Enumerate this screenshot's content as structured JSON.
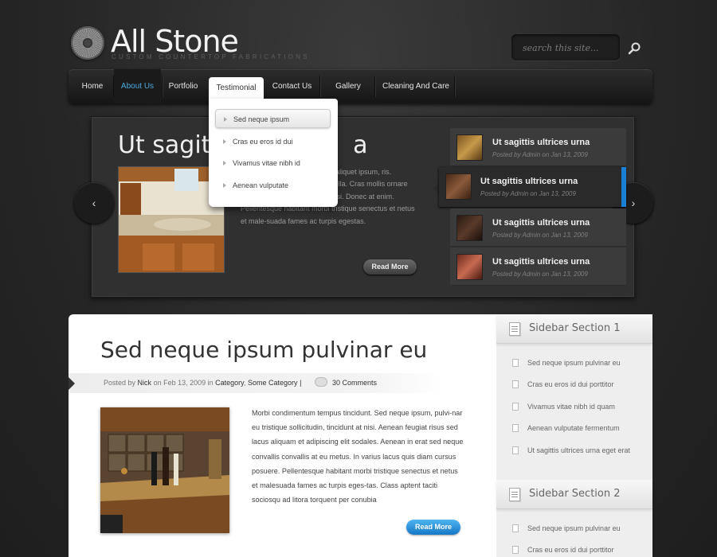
{
  "header": {
    "title": "All Stone",
    "tagline": "CUSTOM COUNTERTOP FABRICATIONS",
    "search_placeholder": "search this site..."
  },
  "nav": {
    "items": [
      "Home",
      "About Us",
      "Portfolio",
      "Testimonial",
      "Contact Us",
      "Gallery",
      "Cleaning And Care"
    ],
    "active": "About Us",
    "open": "Testimonial",
    "dropdown": [
      "Sed neque ipsum",
      "Cras eu eros id dui",
      "Vivamus vitae nibh id",
      "Aenean vulputate"
    ]
  },
  "slider": {
    "title": "Ut sagittis ultrices urna",
    "title_visible": "Ut sagittis",
    "title_tail": "a",
    "text_visible": "ullam vestibulum, odio neque aliquet ipsum, ris. Suspendisse aliquet sem ut nulla. Cras mollis ornare nisl. Morbi ac mi. Nunc eget nisi. Donec at enim. Pellentesque habitant morbi tristique senectus et netus et male-suada fames ac turpis egestas.",
    "read_more": "Read More",
    "prev_arrow": "‹",
    "next_arrow": "›",
    "thumbs": [
      {
        "title": "Ut sagittis ultrices urna",
        "meta": "Posted by Admin on Jan 13, 2009"
      },
      {
        "title": "Ut sagittis ultrices urna",
        "meta": "Posted by Admin on Jan 13, 2009"
      },
      {
        "title": "Ut sagittis ultrices urna",
        "meta": "Posted by Admin on Jan 13, 2009"
      },
      {
        "title": "Ut sagittis ultrices urna",
        "meta": "Posted by Admin on Jan 13, 2009"
      }
    ],
    "active_thumb": 1
  },
  "post": {
    "title": "Sed neque ipsum pulvinar eu",
    "meta_prefix": "Posted by",
    "author": "Nick",
    "meta_on": "on Feb 13, 2009 in",
    "category1": "Category",
    "category2": "Some Category",
    "meta_sep": "|",
    "comments": "30 Comments",
    "body": "Morbi condimentum tempus tincidunt. Sed neque ipsum, pulvi-nar eu tristique sollicitudin, tincidunt at nisi. Aenean feugiat risus sed lacus aliquam et adipiscing elit sodales. Aenean in erat sed neque convallis convallis at eu metus. In varius lacus quis diam cursus posuere. Pellentesque habitant morbi tristique senectus et netus et malesuada fames ac turpis eges-tas. Class aptent taciti sociosqu ad litora torquent per conubia",
    "read_more": "Read More"
  },
  "sidebar": {
    "sections": [
      {
        "title": "Sidebar Section 1",
        "items": [
          "Sed neque ipsum pulvinar eu",
          "Cras eu eros id dui porttitor",
          "Vivamus vitae nibh id quam",
          "Aenean vulputate fermentum",
          "Ut sagittis ultrices urna eget erat"
        ]
      },
      {
        "title": "Sidebar Section 2",
        "items": [
          "Sed neque ipsum pulvinar eu",
          "Cras eu eros id dui porttitor"
        ]
      }
    ]
  },
  "colors": {
    "accent": "#1a7fd6",
    "active_nav": "#4aa8e0",
    "background": "#2a2a2a"
  }
}
